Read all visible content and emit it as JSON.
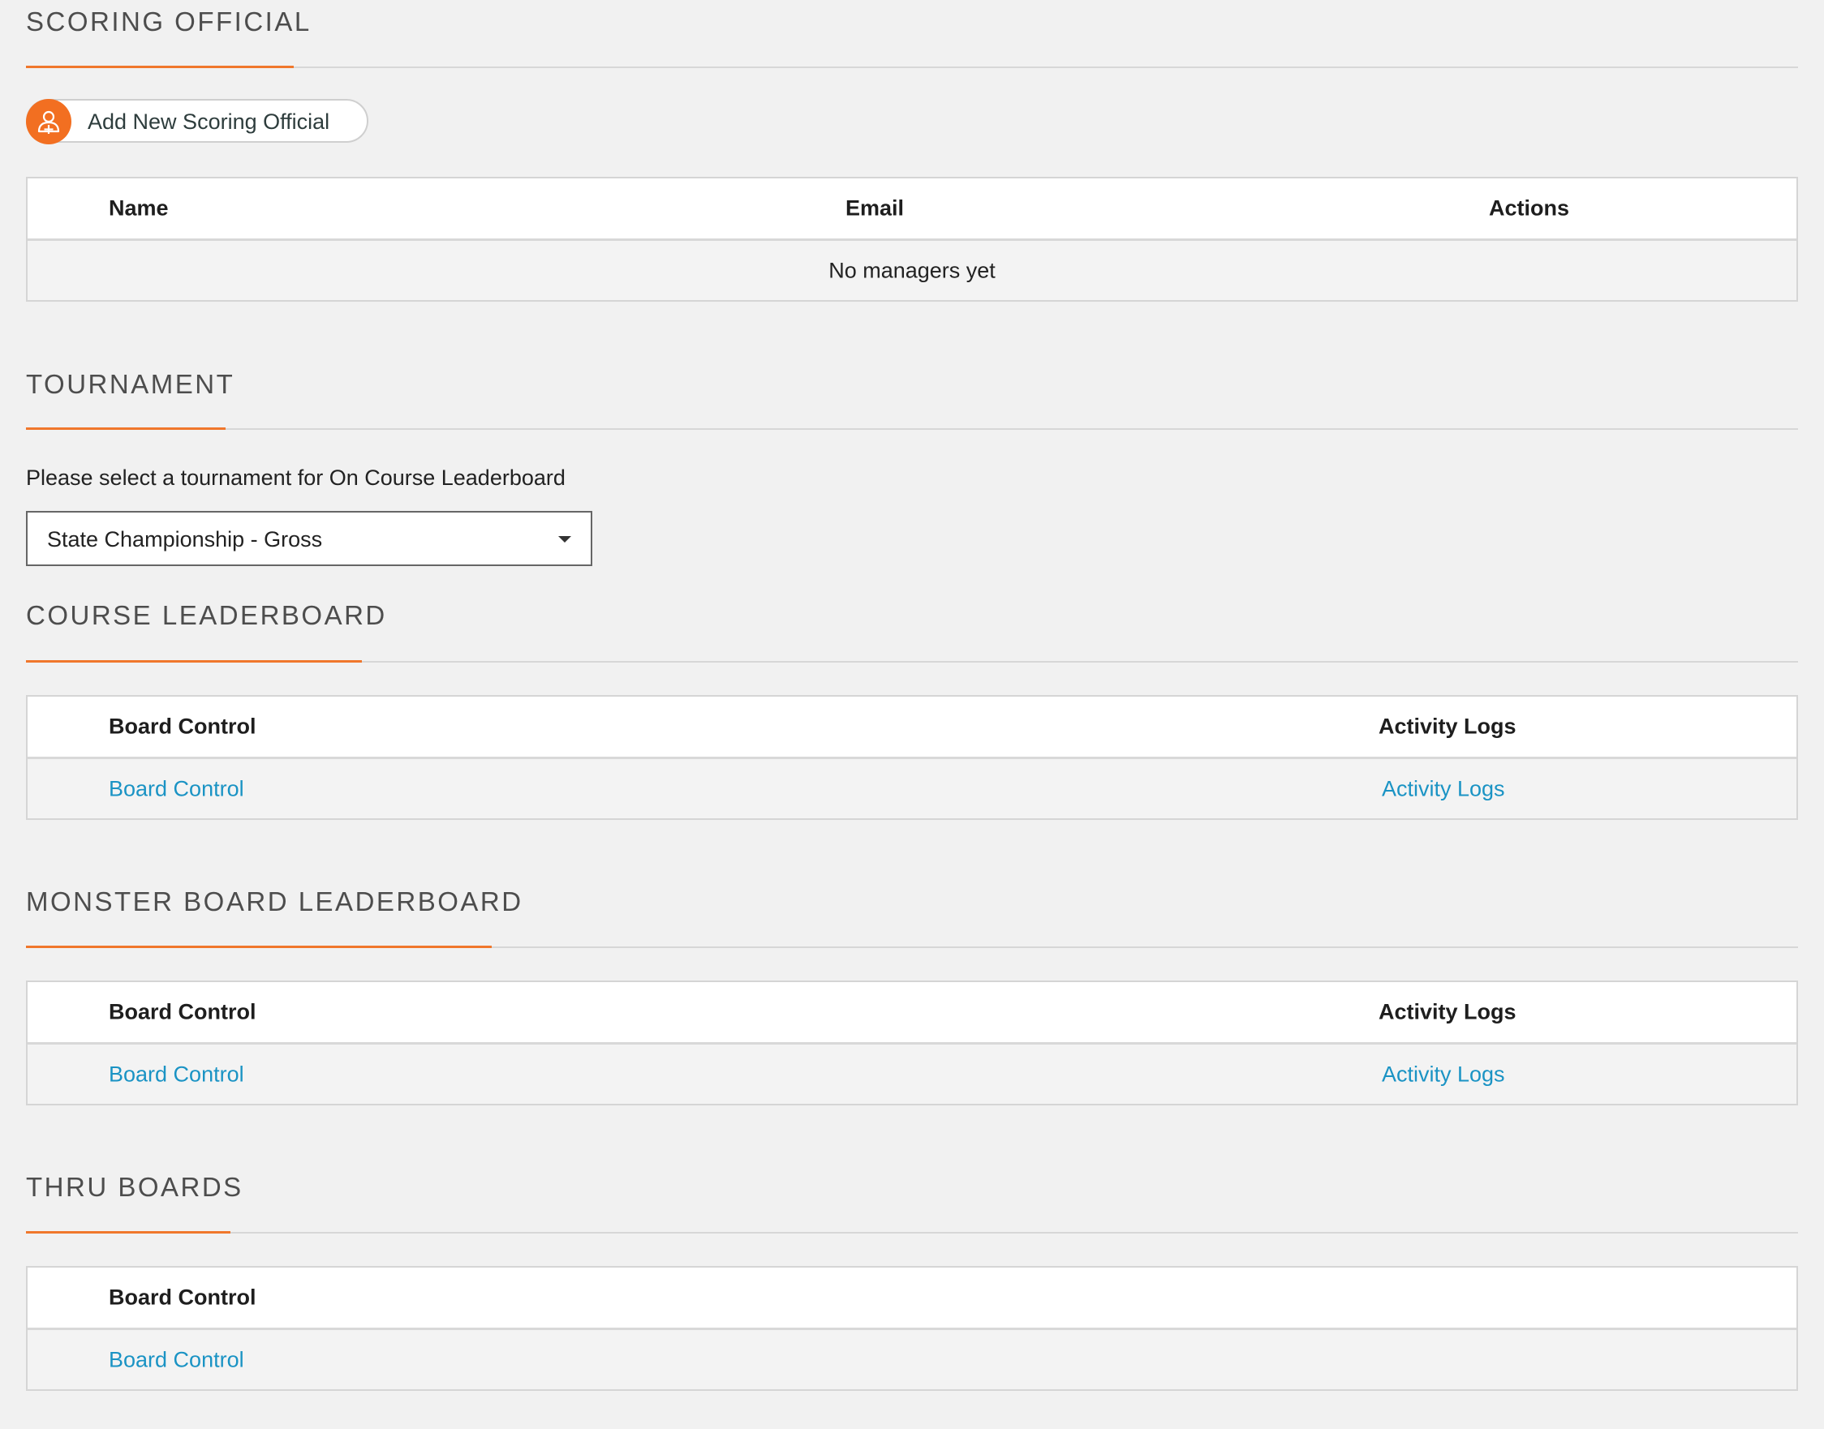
{
  "scoring_official": {
    "title": "SCORING OFFICIAL",
    "add_button_label": "Add New Scoring Official",
    "icon": "add-user-icon",
    "table": {
      "headers": [
        "Name",
        "Email",
        "Actions"
      ],
      "empty_message": "No managers yet"
    }
  },
  "tournament": {
    "title": "TOURNAMENT",
    "prompt": "Please select a tournament for On Course Leaderboard",
    "selected": "State Championship - Gross"
  },
  "course_leaderboard": {
    "title": "COURSE LEADERBOARD",
    "headers": [
      "Board Control",
      "Activity Logs"
    ],
    "links": [
      "Board Control",
      "Activity Logs"
    ]
  },
  "monster_board": {
    "title": "MONSTER BOARD LEADERBOARD",
    "headers": [
      "Board Control",
      "Activity Logs"
    ],
    "links": [
      "Board Control",
      "Activity Logs"
    ]
  },
  "thru_boards": {
    "title": "THRU BOARDS",
    "headers": [
      "Board Control"
    ],
    "links": [
      "Board Control"
    ]
  },
  "colors": {
    "accent": "#f0772c",
    "link": "#1a93c4",
    "background": "#f1f1f1"
  }
}
